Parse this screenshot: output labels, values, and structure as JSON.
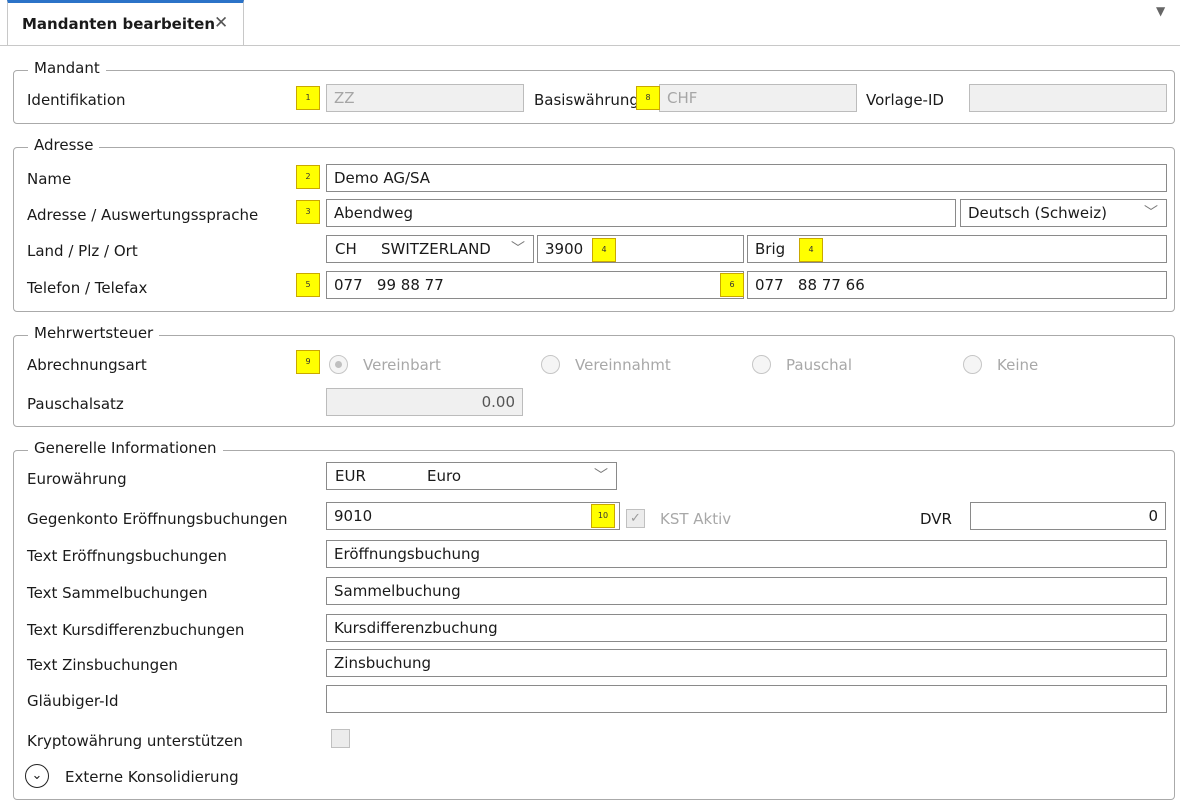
{
  "tab": {
    "title": "Mandanten bearbeiten",
    "close_icon": "close-icon",
    "overflow_icon": "dropdown-arrow-icon"
  },
  "mandant": {
    "legend": "Mandant",
    "identifikation_label": "Identifikation",
    "identifikation_value": "ZZ",
    "basiswaehrung_label": "Basiswährung",
    "basiswaehrung_value": "CHF",
    "vorlage_label": "Vorlage-ID",
    "vorlage_value": ""
  },
  "adresse": {
    "legend": "Adresse",
    "name_label": "Name",
    "name_value": "Demo AG/SA",
    "adresse_label": "Adresse / Auswertungssprache",
    "adresse_value": "Abendweg",
    "sprache_value": "Deutsch (Schweiz)",
    "land_label": "Land / Plz / Ort",
    "land_code": "CH",
    "land_name": "SWITZERLAND",
    "plz_value": "3900",
    "ort_value": "Brig",
    "telefon_label": "Telefon / Telefax",
    "telefon_value": "077   99 88 77",
    "telefax_value": "077   88 77 66"
  },
  "mwst": {
    "legend": "Mehrwertsteuer",
    "abrechnungsart_label": "Abrechnungsart",
    "options": [
      "Vereinbart",
      "Vereinnahmt",
      "Pauschal",
      "Keine"
    ],
    "selected": "Vereinbart",
    "pauschalsatz_label": "Pauschalsatz",
    "pauschalsatz_value": "0.00"
  },
  "generell": {
    "legend": "Generelle Informationen",
    "euro_label": "Eurowährung",
    "euro_code": "EUR",
    "euro_name": "Euro",
    "gegenkonto_label": "Gegenkonto Eröffnungsbuchungen",
    "gegenkonto_value": "9010",
    "kst_label": "KST Aktiv",
    "kst_checked": true,
    "dvr_label": "DVR",
    "dvr_value": "0",
    "text_eroeffnung_label": "Text Eröffnungsbuchungen",
    "text_eroeffnung_value": "Eröffnungsbuchung",
    "text_sammel_label": "Text Sammelbuchungen",
    "text_sammel_value": "Sammelbuchung",
    "text_kursdiff_label": "Text Kursdifferenzbuchungen",
    "text_kursdiff_value": "Kursdifferenzbuchung",
    "text_zins_label": "Text Zinsbuchungen",
    "text_zins_value": "Zinsbuchung",
    "glaeubiger_label": "Gläubiger-Id",
    "glaeubiger_value": "",
    "krypto_label": "Kryptowährung unterstützen",
    "krypto_checked": false
  },
  "expander": {
    "label": "Externe Konsolidierung",
    "icon": "chevron-down-circle-icon"
  },
  "markers": [
    "1",
    "8",
    "2",
    "3",
    "4",
    "4",
    "5",
    "6",
    "9",
    "10"
  ],
  "colors": {
    "accent": "#2b73c8",
    "marker": "#ffff00",
    "disabled_text": "#a6a6a6"
  }
}
